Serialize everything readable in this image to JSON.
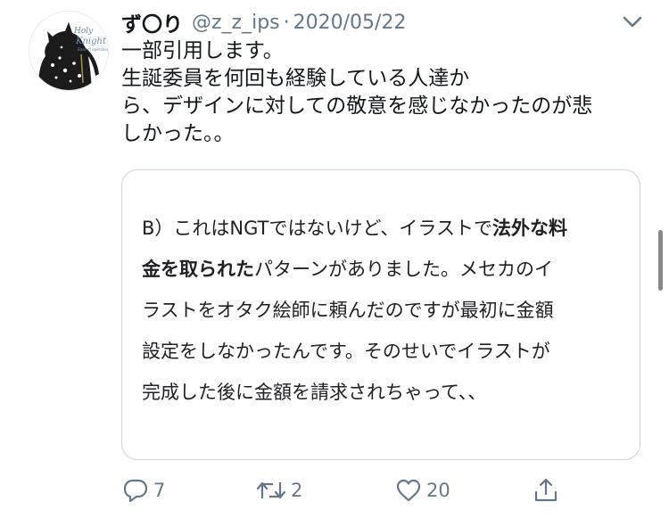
{
  "tweet": {
    "display_name": "ず〇り",
    "handle": "@z_z_ips",
    "separator": "·",
    "date": "2020/05/22",
    "avatar_text": [
      "Holy",
      "Knight",
      "Base of operations"
    ],
    "text_lines": [
      "一部引用します。",
      "生誕委員を何回も経験している人達か",
      "ら、デザインに対しての敬意を感じなかったのが悲",
      "しかった。。"
    ]
  },
  "quoted_card": {
    "line1_plain": "B）これはNGTではないけど、イラストで",
    "line1_bold": "法外な料",
    "line2_bold": "金を取られた",
    "line2_plain": "パターンがありました。メセカのイ",
    "line3": "ラストをオタク絵師に頼んだのですが最初に金額",
    "line4": "設定をしなかったんです。そのせいでイラストが",
    "line5": "完成した後に金額を請求されちゃって、、"
  },
  "actions": {
    "reply_count": "7",
    "retweet_count": "2",
    "like_count": "20"
  },
  "icons": {
    "more": "chevron-down-icon",
    "reply": "reply-icon",
    "retweet": "retweet-icon",
    "like": "heart-icon",
    "share": "share-icon"
  },
  "colors": {
    "text": "#14171a",
    "secondary": "#657786",
    "card_border": "#ccd6dd"
  }
}
